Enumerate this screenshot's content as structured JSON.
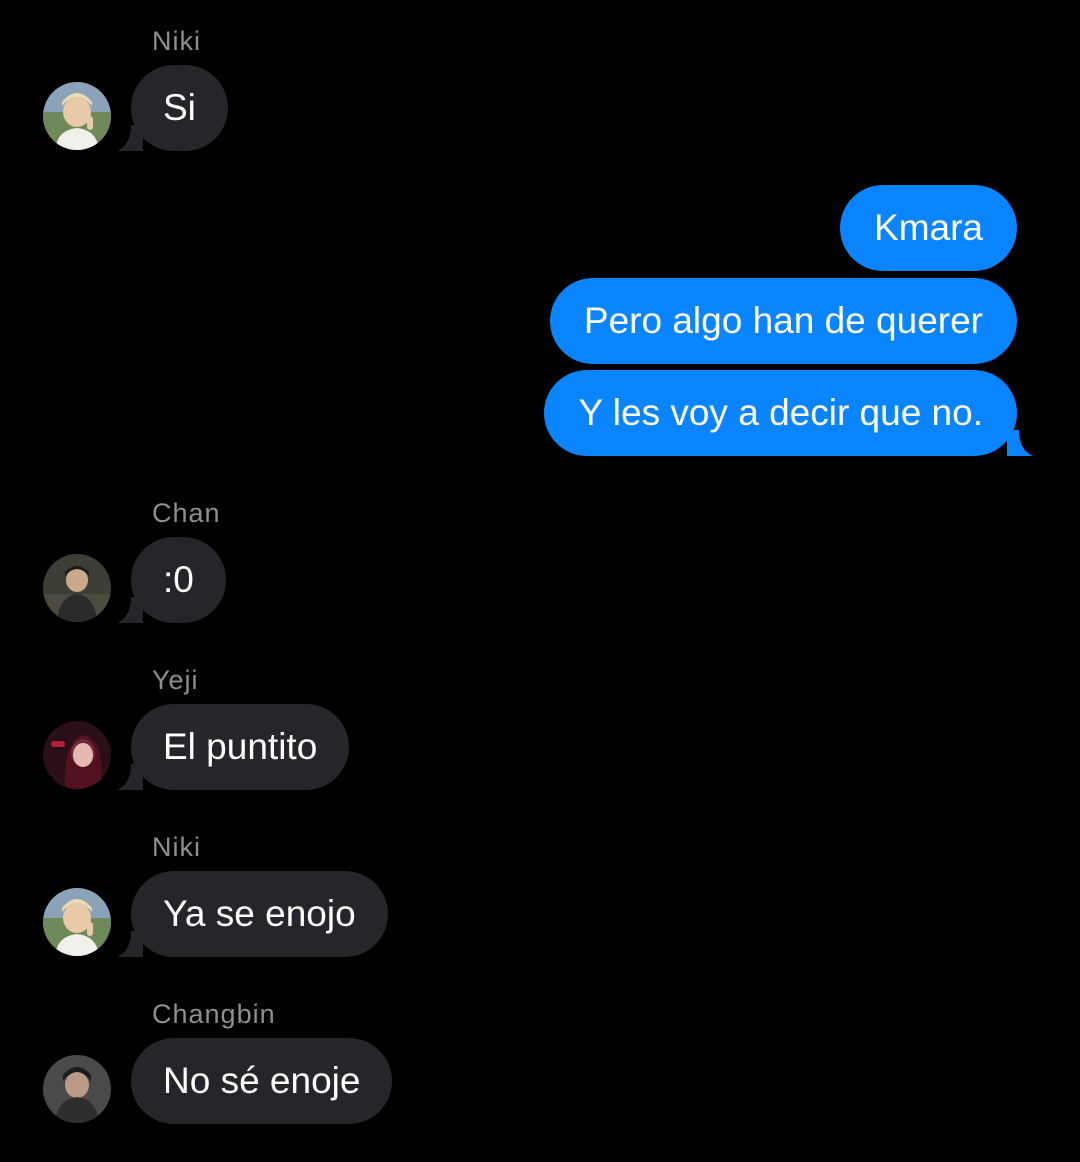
{
  "colors": {
    "background": "#000000",
    "incoming_bubble": "#26252a",
    "outgoing_bubble": "#0a84ff",
    "sender_name": "#8e8e93",
    "text": "#ffffff"
  },
  "messages": [
    {
      "direction": "incoming",
      "sender": "Niki",
      "text": "Si",
      "avatar": "niki-avatar"
    },
    {
      "direction": "outgoing",
      "text": "Kmara"
    },
    {
      "direction": "outgoing",
      "text": "Pero algo han de querer"
    },
    {
      "direction": "outgoing",
      "text": "Y les voy a decir que no."
    },
    {
      "direction": "incoming",
      "sender": "Chan",
      "text": ":0",
      "avatar": "chan-avatar"
    },
    {
      "direction": "incoming",
      "sender": "Yeji",
      "text": "El puntito",
      "avatar": "yeji-avatar"
    },
    {
      "direction": "incoming",
      "sender": "Niki",
      "text": "Ya se enojo",
      "avatar": "niki-avatar"
    },
    {
      "direction": "incoming",
      "sender": "Changbin",
      "text": "No sé enoje",
      "avatar": "changbin-avatar"
    }
  ]
}
